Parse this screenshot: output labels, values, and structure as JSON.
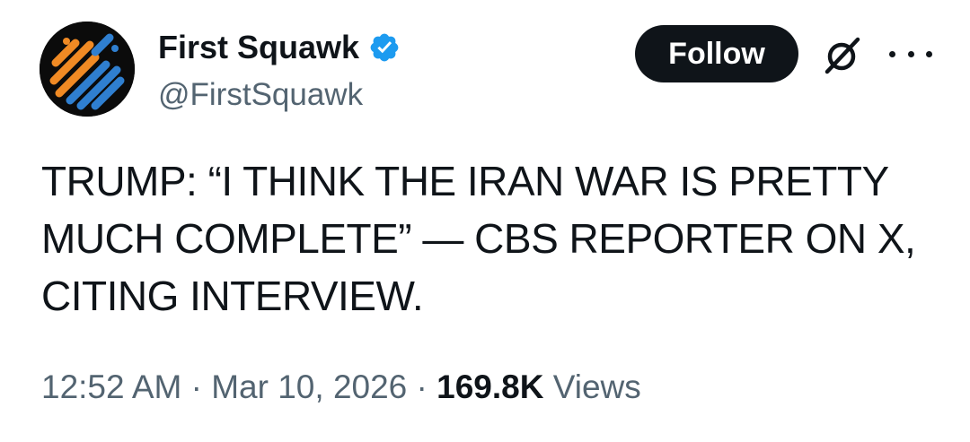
{
  "author": {
    "display_name": "First Squawk",
    "handle": "@FirstSquawk",
    "verified": true,
    "verified_color": "#1d9bf0",
    "avatar_colors": {
      "background": "#0b0b0b",
      "orange": "#f08a24",
      "blue": "#2f7fd0"
    }
  },
  "actions": {
    "follow_label": "Follow",
    "grok_icon": "grok-icon",
    "more_icon": "more-horizontal-icon"
  },
  "tweet": {
    "lines": [
      "TRUMP: “I THINK THE IRAN WAR IS PRETTY",
      "MUCH COMPLETE” — CBS REPORTER ON X,",
      "CITING INTERVIEW."
    ]
  },
  "meta": {
    "time": "12:52 AM",
    "separator": "·",
    "date": "Mar 10, 2026",
    "view_count": "169.8K",
    "views_label": "Views"
  }
}
